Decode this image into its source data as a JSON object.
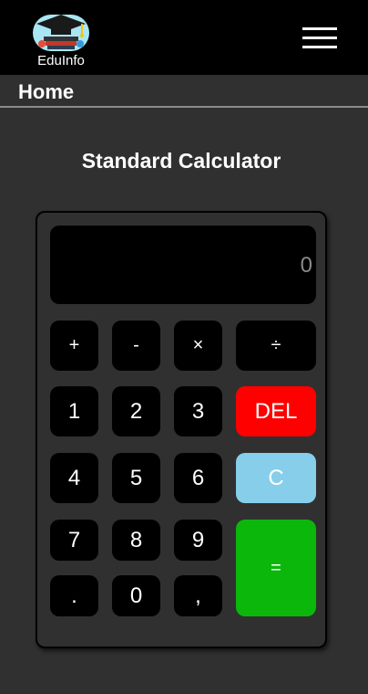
{
  "header": {
    "logo_text": "EduInfo",
    "menu_icon": "hamburger-menu-icon"
  },
  "breadcrumb": "Home",
  "page_title": "Standard Calculator",
  "calculator": {
    "display": "0",
    "keys": {
      "plus": "+",
      "minus": "-",
      "multiply": "×",
      "divide": "÷",
      "one": "1",
      "two": "2",
      "three": "3",
      "delete": "DEL",
      "four": "4",
      "five": "5",
      "six": "6",
      "clear": "C",
      "seven": "7",
      "eight": "8",
      "nine": "9",
      "equals": "=",
      "dot": ".",
      "zero": "0",
      "comma": ","
    }
  },
  "colors": {
    "background": "#303030",
    "key": "#000000",
    "delete": "#ff0000",
    "clear": "#87ceeb",
    "equals": "#0bb70b"
  }
}
